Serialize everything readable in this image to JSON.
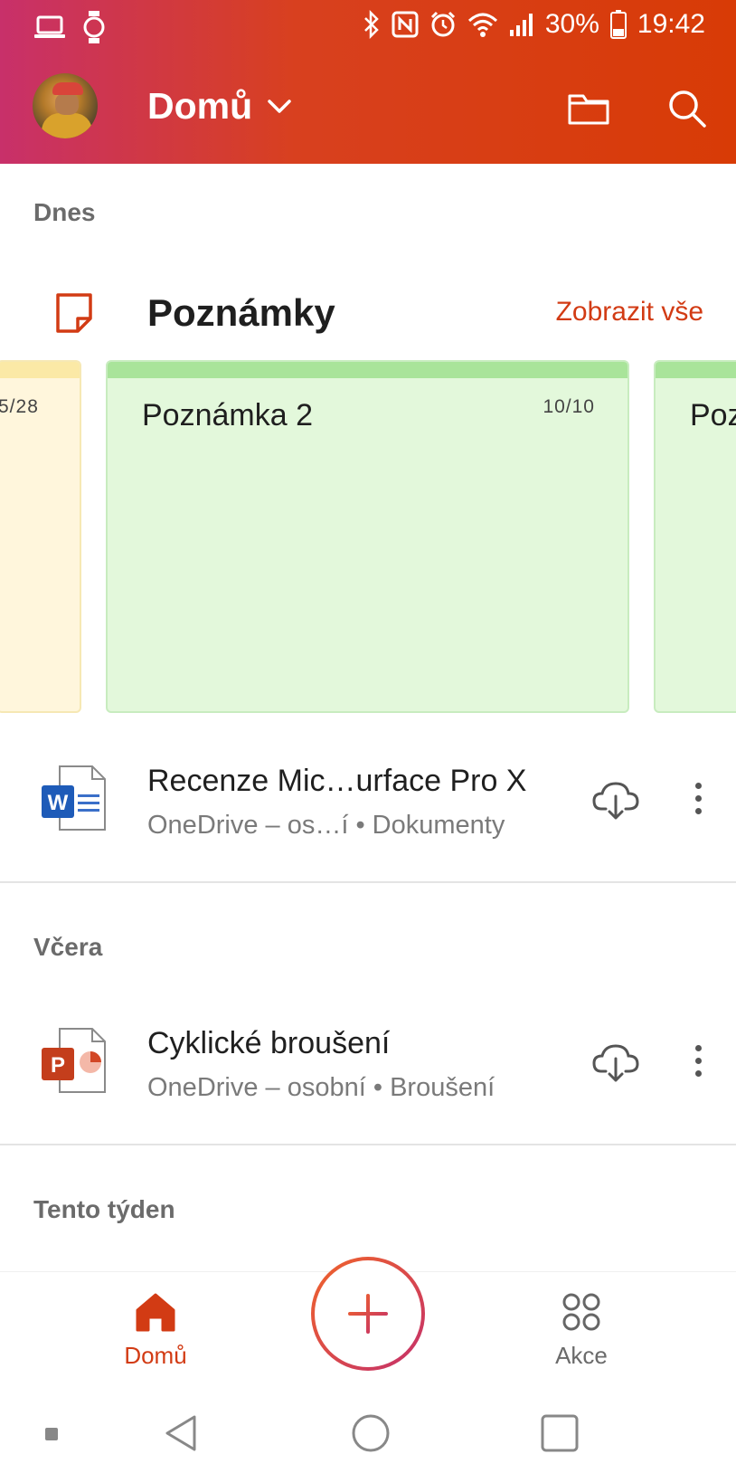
{
  "status_bar": {
    "battery": "30%",
    "time": "19:42"
  },
  "header": {
    "title": "Domů",
    "colors": {
      "gradient_start": "#c8306a",
      "gradient_end": "#d83b06"
    }
  },
  "sections": {
    "today": "Dnes",
    "yesterday": "Včera",
    "this_week": "Tento týden"
  },
  "notes": {
    "title": "Poznámky",
    "show_all": "Zobrazit vše",
    "items": [
      {
        "title": "",
        "date": "5/28"
      },
      {
        "title": "Poznámka 2",
        "date": "10/10"
      },
      {
        "title": "Poz",
        "date": ""
      }
    ]
  },
  "files": [
    {
      "type": "word",
      "name": "Recenze Mic…urface Pro X",
      "subtitle": "OneDrive – os…í • Dokumenty"
    },
    {
      "type": "powerpoint",
      "name": "Cyklické broušení",
      "subtitle": "OneDrive – osobní • Broušení"
    }
  ],
  "bottom_nav": {
    "home": "Domů",
    "actions": "Akce"
  },
  "accent_color": "#d23b14"
}
